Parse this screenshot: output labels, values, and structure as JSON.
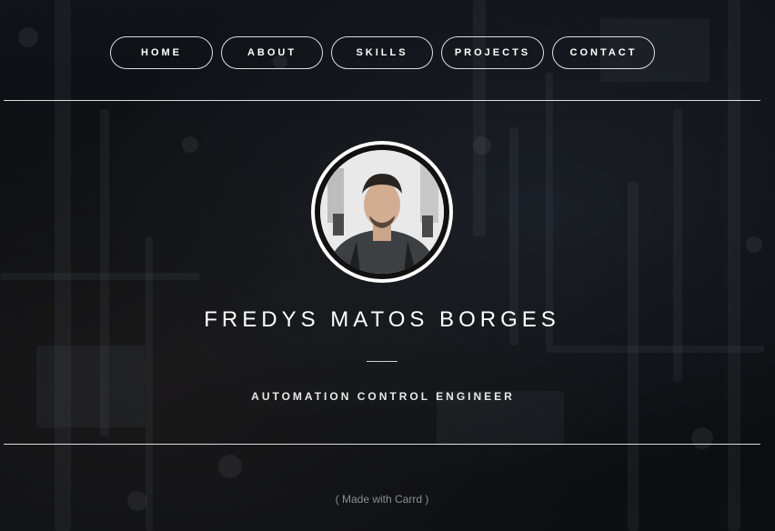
{
  "nav": {
    "items": [
      {
        "label": "HOME"
      },
      {
        "label": "ABOUT"
      },
      {
        "label": "SKILLS"
      },
      {
        "label": "PROJECTS"
      },
      {
        "label": "CONTACT"
      }
    ]
  },
  "profile": {
    "name": "FREDYS MATOS BORGES",
    "title": "AUTOMATION CONTROL ENGINEER",
    "avatar_icon": "profile-photo"
  },
  "footer": {
    "credit": "( Made with Carrd )"
  },
  "colors": {
    "background": "#0b0d10",
    "text": "#ffffff",
    "muted": "#8a8d92"
  }
}
